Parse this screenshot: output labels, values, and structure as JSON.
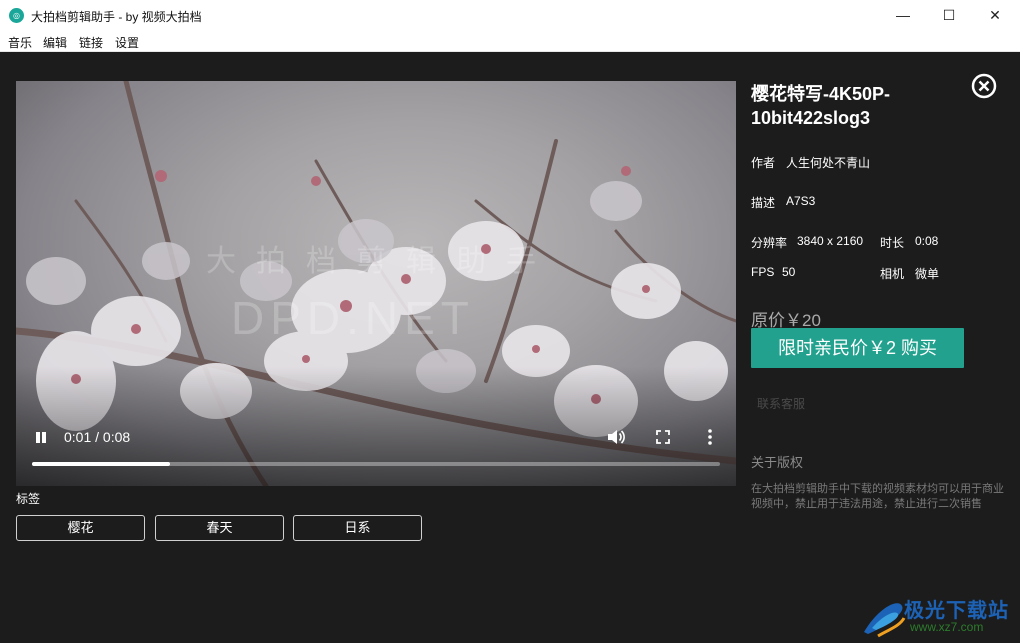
{
  "window": {
    "icon": "film-reel-icon",
    "title": "大拍档剪辑助手 - by 视频大拍档",
    "controls": {
      "minimize": "—",
      "maximize": "☐",
      "close": "✕"
    }
  },
  "menu": {
    "items": [
      "音乐",
      "编辑",
      "链接",
      "设置"
    ]
  },
  "player": {
    "watermark_cn": "大拍档剪辑助手",
    "watermark_en": "DPD.NET",
    "time": "0:01 / 0:08",
    "progress": 0.2
  },
  "tags": {
    "label": "标签",
    "items": [
      "樱花",
      "春天",
      "日系"
    ]
  },
  "detail": {
    "title": "樱花特写-4K50P-10bit422slog3",
    "author_label": "作者",
    "author": "人生何处不青山",
    "desc_label": "描述",
    "desc": "A7S3",
    "res_label": "分辨率",
    "res": "3840 x 2160",
    "dur_label": "时长",
    "dur": "0:08",
    "fps_label": "FPS",
    "fps": "50",
    "camera_label": "相机",
    "camera": "微单",
    "orig_price": "原价￥20",
    "buy_label": "限时亲民价￥2 购买",
    "contact": "联系客服",
    "copyright_title": "关于版权",
    "copyright_text": "在大拍档剪辑助手中下载的视频素材均可以用于商业视频中，禁止用于违法用途，禁止进行二次销售"
  },
  "brand": {
    "name": "极光下载站",
    "url": "www.xz7.com"
  },
  "colors": {
    "accent": "#22a28e",
    "background": "#1c1c1c"
  }
}
